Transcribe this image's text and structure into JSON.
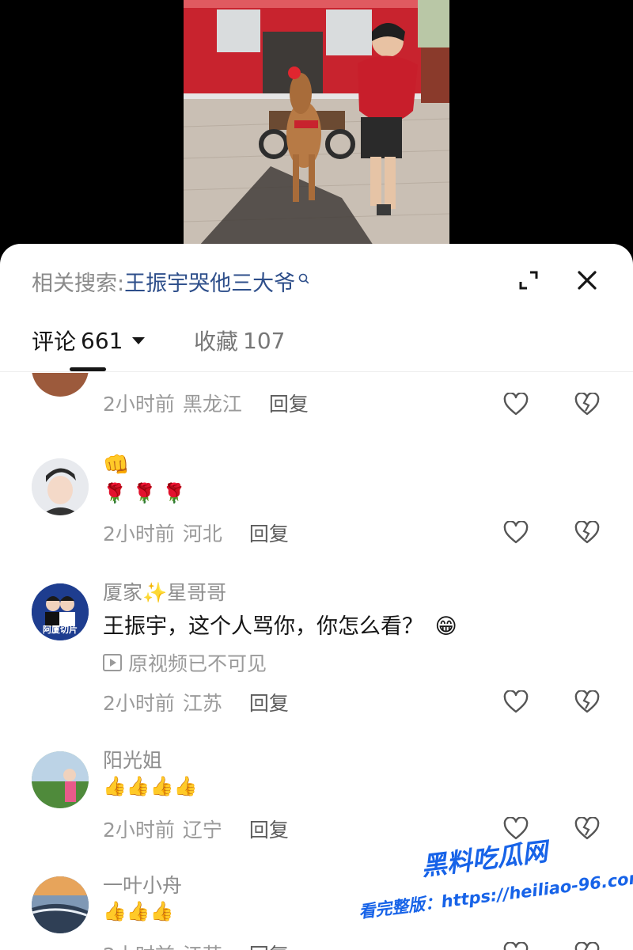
{
  "header": {
    "related_label": "相关搜索:",
    "related_query": "王振宇哭他三大爷"
  },
  "tabs": {
    "comments_label": "评论",
    "comments_count": "661",
    "favorites_label": "收藏",
    "favorites_count": "107"
  },
  "comments": [
    {
      "username": "",
      "text": "👍👍👍",
      "time": "2小时前",
      "location": "黑龙江",
      "reply_label": "回复"
    },
    {
      "username": "",
      "text": "👊",
      "text2": "🌹 🌹 🌹",
      "time": "2小时前",
      "location": "河北",
      "reply_label": "回复"
    },
    {
      "username_prefix": "厦家",
      "username_spark": "✨",
      "username_suffix": "星哥哥",
      "text": "王振宇，这个人骂你，你怎么看？",
      "text_emoji": "😁",
      "note": "原视频已不可见",
      "avatar_text": "阿厦切片",
      "time": "2小时前",
      "location": "江苏",
      "reply_label": "回复"
    },
    {
      "username": "阳光姐",
      "text": "👍👍👍👍",
      "time": "2小时前",
      "location": "辽宁",
      "reply_label": "回复"
    },
    {
      "username": "一叶小舟",
      "text": "👍👍👍",
      "time": "2小时前",
      "location": "江苏",
      "reply_label": "回复"
    }
  ],
  "watermark": {
    "logo": "黑料吃瓜网",
    "url": "看完整版：https://heiliao-96.com"
  },
  "colors": {
    "accent_blue": "#2d4e8a",
    "text_dark": "#161616",
    "text_gray": "#9a9a9a",
    "watermark_blue": "#1763e8"
  },
  "icons": [
    "search-icon",
    "expand-icon",
    "close-icon",
    "caret-down-icon",
    "heart-icon",
    "broken-heart-icon",
    "play-box-icon"
  ]
}
